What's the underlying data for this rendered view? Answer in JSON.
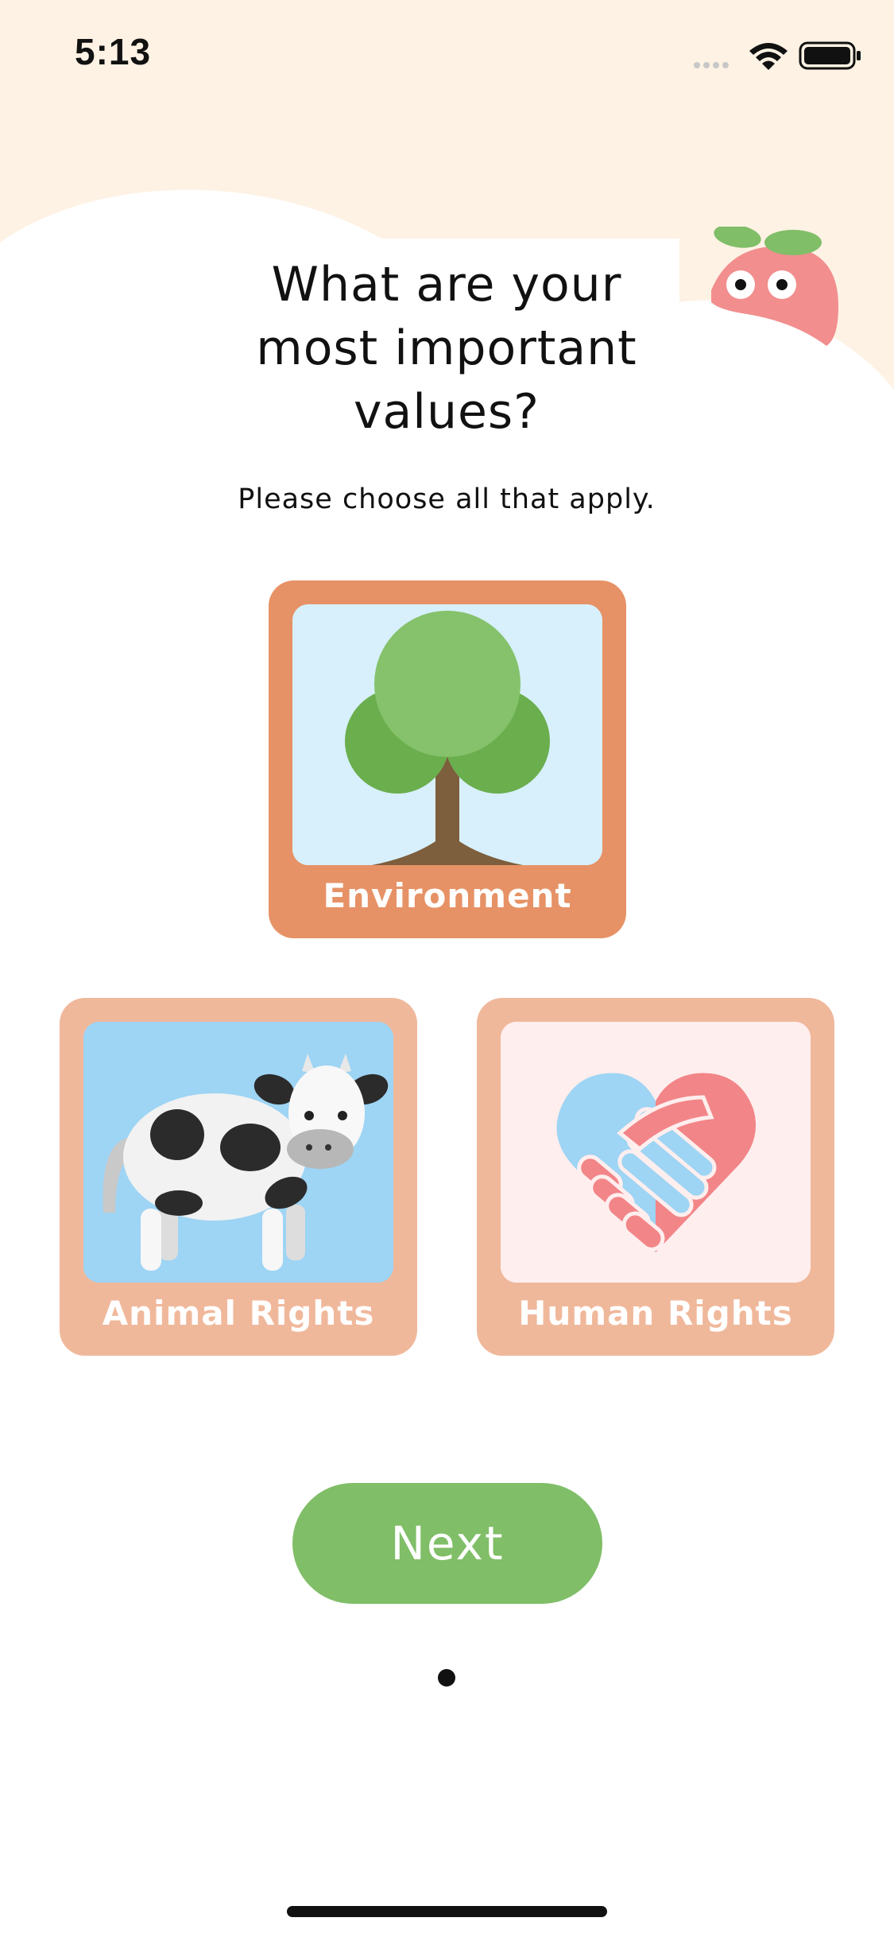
{
  "status_bar": {
    "time": "5:13",
    "icons": [
      "signal-icon",
      "wifi-icon",
      "battery-icon"
    ]
  },
  "header": {
    "title_lines": [
      "What are your",
      "most important",
      "values?"
    ],
    "subtitle": "Please choose all that apply."
  },
  "options": [
    {
      "label": "Environment",
      "selected": true,
      "icon": "tree-icon"
    },
    {
      "label": "Animal Rights",
      "selected": false,
      "icon": "cow-icon"
    },
    {
      "label": "Human Rights",
      "selected": false,
      "icon": "heart-handshake-icon"
    }
  ],
  "next_button": {
    "label": "Next"
  },
  "pagination": {
    "current": 1,
    "total": 1
  },
  "colors": {
    "background_top": "#fef2e4",
    "selected_card": "#e69266",
    "unselected_card": "#f0b89b",
    "next_button": "#80be68",
    "env_bg": "#d7f0fb",
    "animal_bg": "#9ed4f4",
    "human_bg": "#ffeeee"
  }
}
